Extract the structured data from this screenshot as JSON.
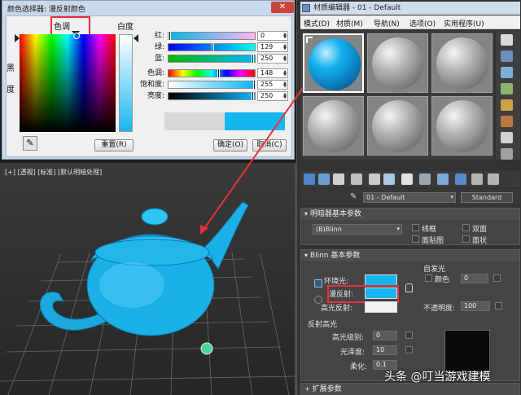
{
  "color_picker": {
    "title": "颜色选择器: 漫反射颜色",
    "hue_heading": "色调",
    "whiteness_label": "白度",
    "black_label": "黑\n度",
    "sliders": [
      {
        "label": "红:",
        "value": "0",
        "fraction": 0.0,
        "gradient": "linear-gradient(to right, #00b7f0, #ffb7f0)"
      },
      {
        "label": "绿:",
        "value": "129",
        "fraction": 0.51,
        "gradient": "linear-gradient(to right, #0000f0, #00fff0)"
      },
      {
        "label": "蓝:",
        "value": "250",
        "fraction": 0.98,
        "gradient": "linear-gradient(to right, #00b700, #00b7ff)"
      },
      {
        "label": "色调:",
        "value": "148",
        "fraction": 0.58,
        "gradient": "linear-gradient(to right, #ff0000, #ffff00, #00ff00, #00ffff, #0000ff, #ff00ff, #ff0000)"
      },
      {
        "label": "饱和度:",
        "value": "255",
        "fraction": 1.0,
        "gradient": "linear-gradient(to right, #ffffff, #00b7ff)"
      },
      {
        "label": "亮度:",
        "value": "250",
        "fraction": 0.98,
        "gradient": "linear-gradient(to right, #000000, #00b7ff)"
      }
    ],
    "reset_button": "重置(R)",
    "ok_button": "确定(O)",
    "cancel_button": "取消(C)",
    "old_color": "#d8d8d8",
    "new_color": "#15b7f0"
  },
  "viewport": {
    "label": "[+] [透视] [标准] [默认明暗处理]"
  },
  "material_editor": {
    "title": "材质编辑器 - 01 - Default",
    "menu": [
      "模式(D)",
      "材质(M)",
      "导航(N)",
      "选项(O)",
      "实用程序(U)"
    ],
    "material_name": "01 - Default",
    "material_type": "Standard",
    "shader_rollout": {
      "title": "明暗器基本参数",
      "shader": "(B)Blinn",
      "options": [
        "线框",
        "双面",
        "面贴图",
        "面状"
      ]
    },
    "blinn_rollout": {
      "title": "Blinn 基本参数",
      "ambient_label": "环境光:",
      "diffuse_label": "漫反射:",
      "specular_label": "高光反射:",
      "self_illum_heading": "自发光",
      "color_label": "颜色",
      "color_value": "0",
      "opacity_label": "不透明度:",
      "opacity_value": "100",
      "ambient_color": "#15b7f0",
      "diffuse_color": "#15b7f0",
      "specular_color": "#ffffff"
    },
    "highlights": {
      "title": "反射高光",
      "level_label": "高光级别:",
      "level_value": "0",
      "gloss_label": "光泽度:",
      "gloss_value": "10",
      "soften_label": "柔化:",
      "soften_value": "0.1"
    },
    "extended_rollout": {
      "title": "扩展参数"
    }
  },
  "watermark": "头条 @叮当游戏建模"
}
